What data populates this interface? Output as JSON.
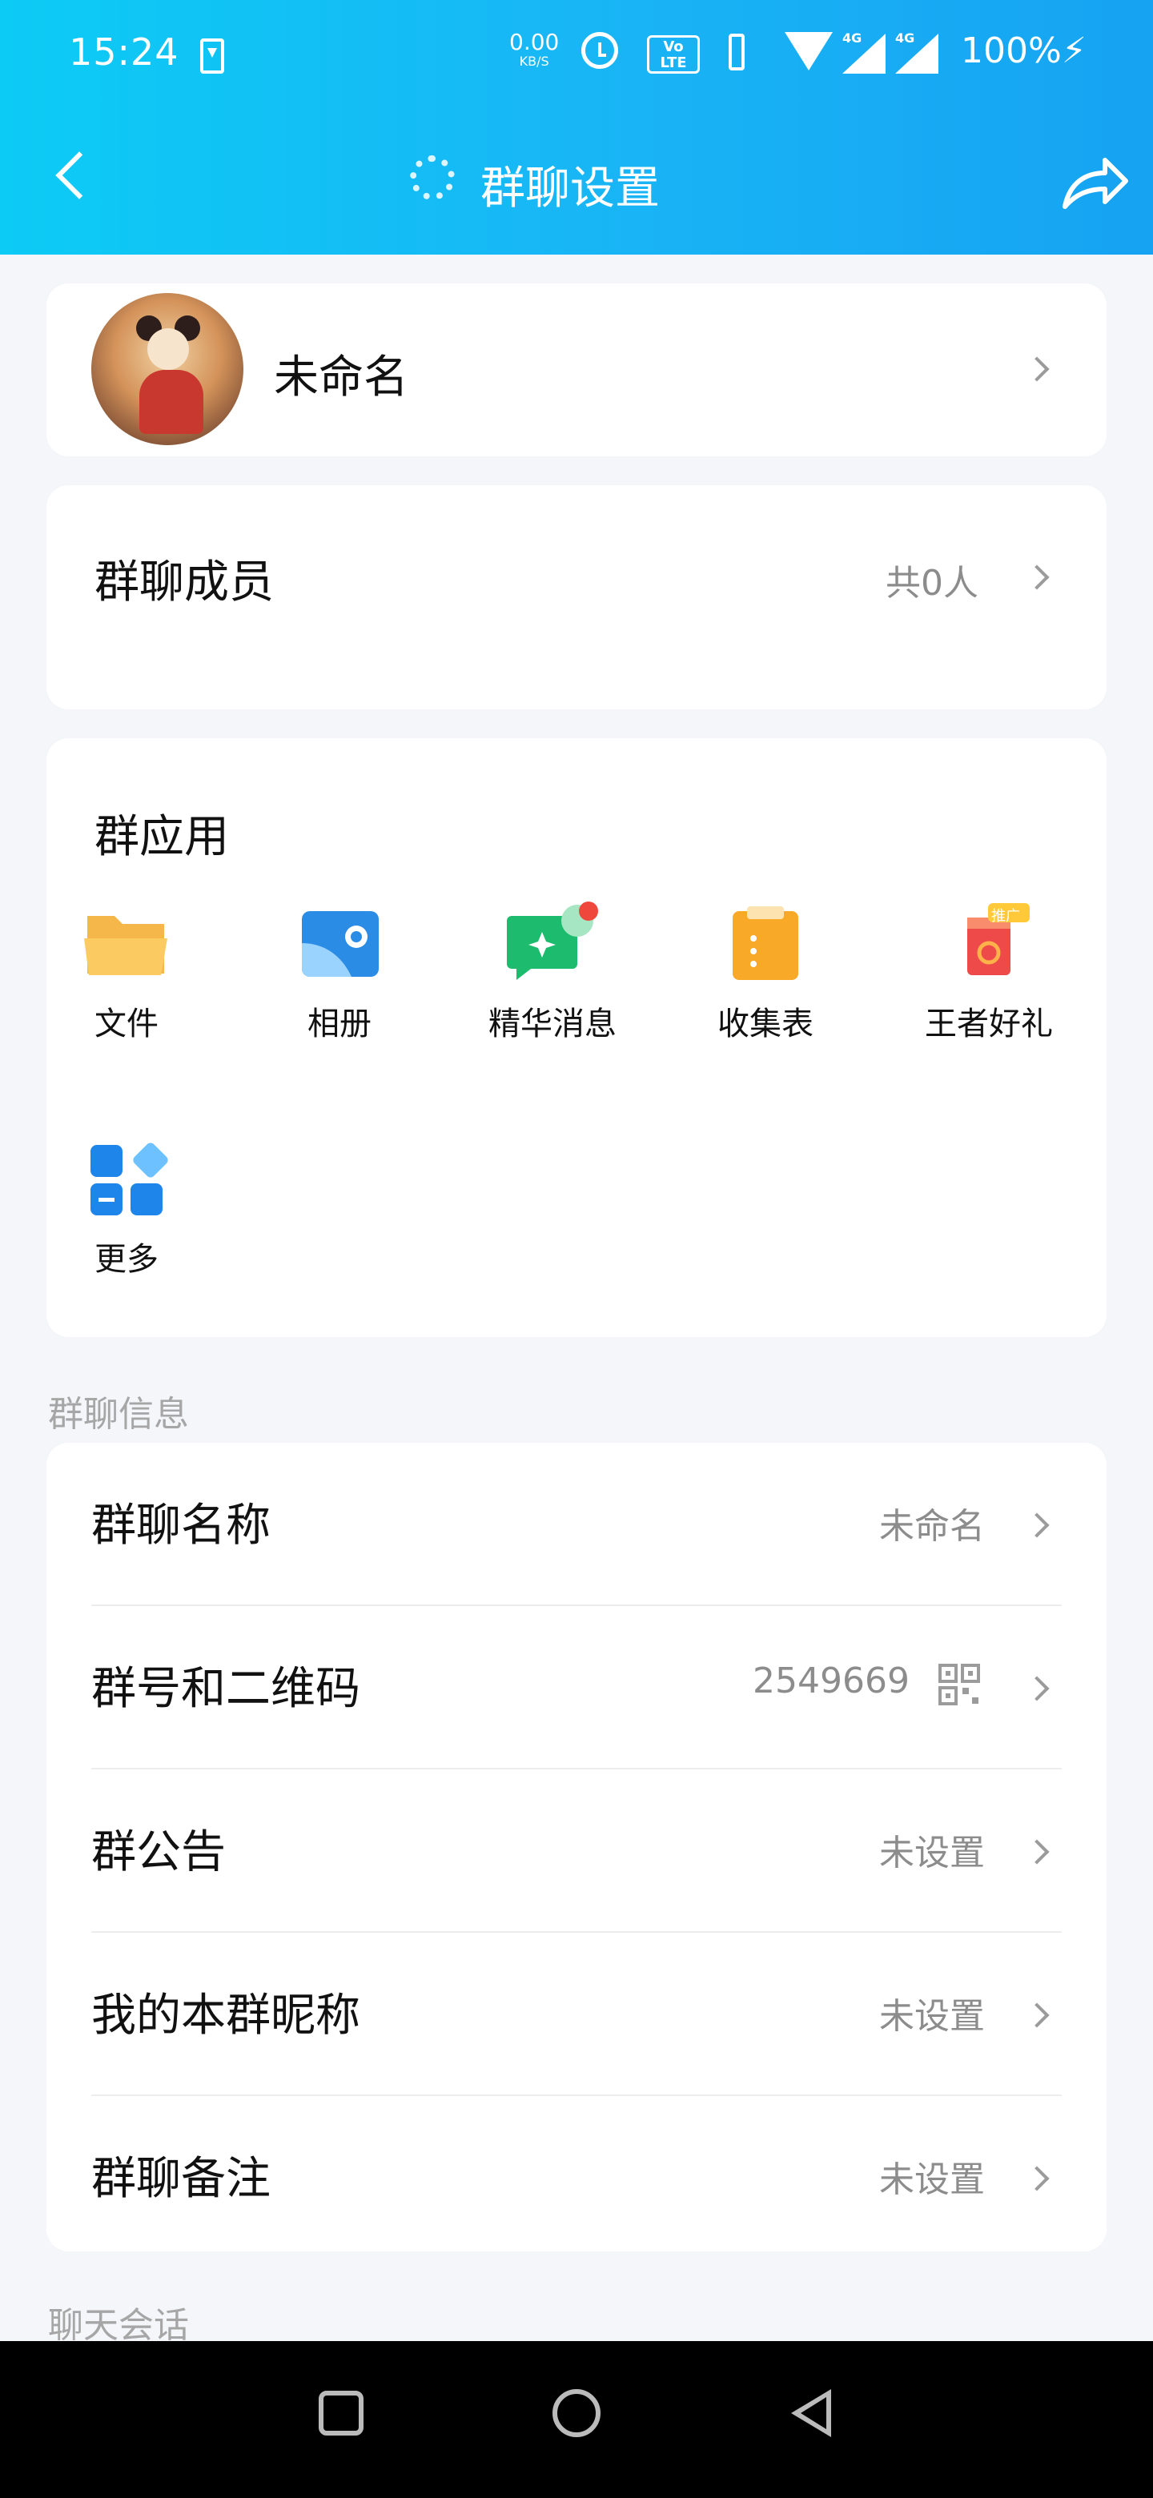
{
  "status_bar": {
    "time": "15:24",
    "net_speed": "0.00",
    "net_unit": "KB/S",
    "volte": "Vo LTE",
    "sig1_label": "4G",
    "sig2_label": "4G",
    "battery": "100%"
  },
  "nav": {
    "title": "群聊设置"
  },
  "profile": {
    "name": "未命名"
  },
  "members": {
    "title": "群聊成员",
    "count": "共0人"
  },
  "apps": {
    "title": "群应用",
    "items": [
      {
        "label": "文件",
        "icon": "folder-icon"
      },
      {
        "label": "相册",
        "icon": "album-icon"
      },
      {
        "label": "精华消息",
        "icon": "highlight-message-icon"
      },
      {
        "label": "收集表",
        "icon": "clipboard-icon"
      },
      {
        "label": "王者好礼",
        "icon": "gift-icon",
        "badge": "推广"
      },
      {
        "label": "更多",
        "icon": "more-apps-icon"
      }
    ]
  },
  "info": {
    "section_label": "群聊信息",
    "rows": [
      {
        "title": "群聊名称",
        "value": "未命名"
      },
      {
        "title": "群号和二维码",
        "value": "2549669"
      },
      {
        "title": "群公告",
        "value": "未设置"
      },
      {
        "title": "我的本群昵称",
        "value": "未设置"
      },
      {
        "title": "群聊备注",
        "value": "未设置"
      }
    ]
  },
  "next_section_label": "聊天会话",
  "colors": {
    "header_start": "#0CCBF5",
    "header_end": "#16A3F2",
    "page_bg": "#F5F6FA",
    "secondary_text": "#8C8C8C"
  }
}
